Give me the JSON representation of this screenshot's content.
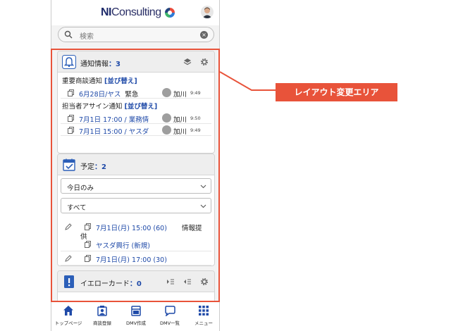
{
  "header": {
    "logo_prefix": "NI",
    "logo_suffix": "Consulting"
  },
  "search": {
    "placeholder": "検索"
  },
  "notifications": {
    "title": "通知情報",
    "count_text": "：3",
    "groups": [
      {
        "label": "重要商談通知",
        "sort_label": "[並び替え]",
        "items": [
          {
            "text": "6月28日/ヤス",
            "tag": "緊急",
            "user": "加川",
            "time": "9:49"
          }
        ]
      },
      {
        "label": "担当者アサイン通知",
        "sort_label": "[並び替え]",
        "items": [
          {
            "text": "7月1日 17:00 / 業務情",
            "user": "加川",
            "time": "9:50"
          },
          {
            "text": "7月1日 15:00 / ヤスダ",
            "user": "加川",
            "time": "9:49"
          }
        ]
      }
    ]
  },
  "schedule": {
    "title": "予定",
    "count_text": "：2",
    "filter_period": "今日のみ",
    "filter_type": "すべて",
    "items": [
      {
        "text": "7月1日(月) 15:00 (60)",
        "desc": "情報提",
        "desc_wrap": "供",
        "sub": "ヤスダ興行 (新規)"
      },
      {
        "text": "7月1日(月) 17:00 (30)"
      }
    ]
  },
  "yellow_card": {
    "title": "イエローカード",
    "count_text": "：0"
  },
  "bottom_nav": [
    {
      "label": "トップページ",
      "icon": "home-icon"
    },
    {
      "label": "商談登録",
      "icon": "meeting-register-icon"
    },
    {
      "label": "DMV作成",
      "icon": "dmv-create-icon"
    },
    {
      "label": "DMV一覧",
      "icon": "dmv-list-icon"
    },
    {
      "label": "メニュー",
      "icon": "menu-grid-icon"
    }
  ],
  "annotation": {
    "label": "レイアウト変更エリア"
  },
  "colors": {
    "accent": "#1f4aa8",
    "highlight": "#e8533a"
  }
}
